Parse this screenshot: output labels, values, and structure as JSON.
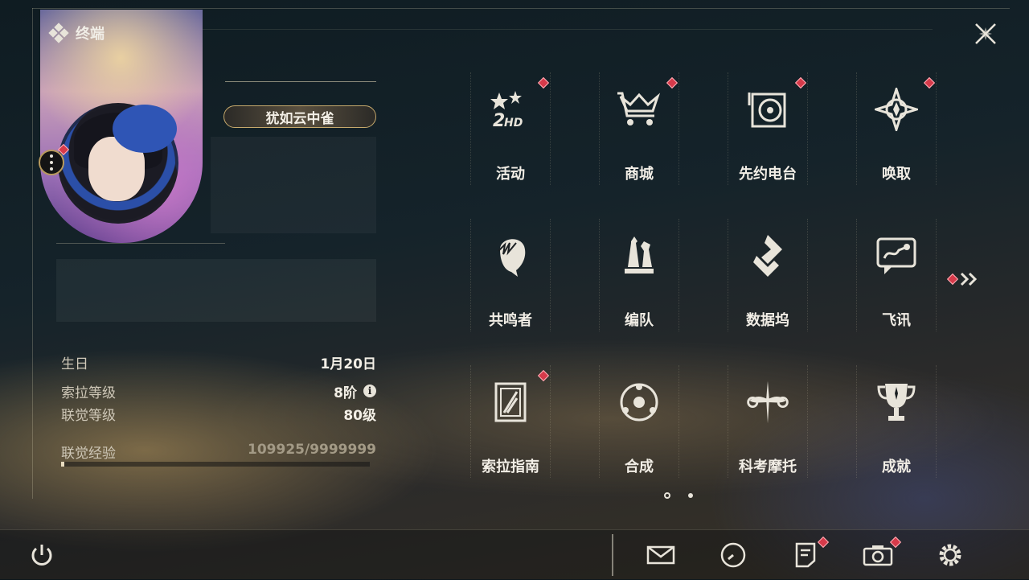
{
  "header": {
    "title": "终端",
    "close_icon": "close-icon"
  },
  "profile": {
    "name": "犹如云中雀",
    "avatar": "character-avatar",
    "more_icon": "more-options-icon"
  },
  "stats": [
    {
      "label": "生日",
      "value": "1月20日"
    },
    {
      "label": "索拉等级",
      "value": "8阶",
      "info": "i"
    },
    {
      "label": "联觉等级",
      "value": "80级"
    }
  ],
  "experience": {
    "label": "联觉经验",
    "value": "109925/9999999",
    "progress": 0.011
  },
  "menu": [
    {
      "label": "活动",
      "icon": "activity-2hd-icon",
      "badge": true
    },
    {
      "label": "商城",
      "icon": "crown-cart-icon",
      "badge": true
    },
    {
      "label": "先约电台",
      "icon": "radio-record-icon",
      "badge": true
    },
    {
      "label": "唤取",
      "icon": "convene-compass-icon",
      "badge": true
    },
    {
      "label": "共鸣者",
      "icon": "resonator-head-icon",
      "badge": false
    },
    {
      "label": "编队",
      "icon": "chess-pieces-icon",
      "badge": false
    },
    {
      "label": "数据坞",
      "icon": "data-bank-icon",
      "badge": false
    },
    {
      "label": "飞讯",
      "icon": "chat-bubble-icon",
      "badge": false
    },
    {
      "label": "索拉指南",
      "icon": "guidebook-icon",
      "badge": true
    },
    {
      "label": "合成",
      "icon": "synthesis-ring-icon",
      "badge": false
    },
    {
      "label": "科考摩托",
      "icon": "motorcycle-icon",
      "badge": false
    },
    {
      "label": "成就",
      "icon": "trophy-icon",
      "badge": false
    }
  ],
  "pagination": {
    "current": 1,
    "total": 2
  },
  "bottom_bar": {
    "power_icon": "power-icon",
    "items": [
      {
        "icon": "mail-icon",
        "badge": false
      },
      {
        "icon": "clock-icon",
        "badge": false
      },
      {
        "icon": "notice-icon",
        "badge": true
      },
      {
        "icon": "camera-icon",
        "badge": true
      },
      {
        "icon": "gear-icon",
        "badge": false
      }
    ]
  },
  "colors": {
    "badge": "#d63a4a",
    "accent_gold": "#c6a96c",
    "text": "#f2eee6"
  }
}
